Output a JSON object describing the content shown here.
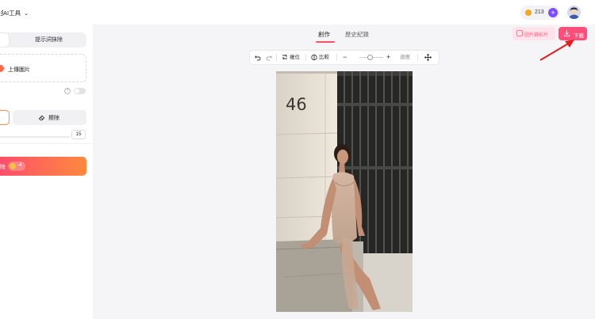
{
  "header": {
    "app_title": "AI工具",
    "app_title_prefix": "多",
    "credits": "213"
  },
  "left_panel": {
    "tab_prompt_erase": "提示詞抹除",
    "upload_label": "上傳圖片",
    "erase_button": "擦除",
    "brush_size": "15",
    "generate_label": "除",
    "generate_cost": "-4"
  },
  "main": {
    "tab_create": "創作",
    "tab_history": "歷史紀錄",
    "batch_button": "圖片轉影片",
    "download_button": "下載",
    "toolbar": {
      "reset": "複位",
      "compare": "比較",
      "fit": "適應"
    },
    "photo": {
      "house_number": "46"
    }
  },
  "colors": {
    "accent": "#ff4e6a",
    "gradient_end": "#ff8a3d",
    "annotation_arrow": "#e02020"
  }
}
